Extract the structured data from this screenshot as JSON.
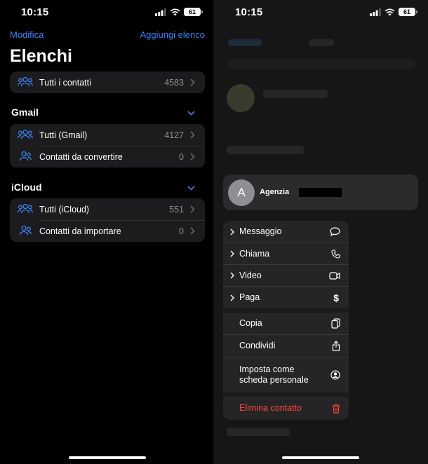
{
  "left_screen": {
    "status": {
      "time": "10:15",
      "battery": "61"
    },
    "nav": {
      "edit": "Modifica",
      "add_list": "Aggiungi elenco"
    },
    "title": "Elenchi",
    "all_contacts": {
      "label": "Tutti i contatti",
      "count": "4583"
    },
    "sections": [
      {
        "title": "Gmail",
        "rows": [
          {
            "label": "Tutti (Gmail)",
            "count": "4127"
          },
          {
            "label": "Contatti da convertire",
            "count": "0"
          }
        ]
      },
      {
        "title": "iCloud",
        "rows": [
          {
            "label": "Tutti (iCloud)",
            "count": "551"
          },
          {
            "label": "Contatti da importare",
            "count": "0"
          }
        ]
      }
    ]
  },
  "right_screen": {
    "status": {
      "time": "10:15",
      "battery": "61"
    },
    "contact": {
      "initial": "A",
      "name": "Agenzia"
    },
    "menu": {
      "message": "Messaggio",
      "call": "Chiama",
      "video": "Video",
      "pay": "Paga",
      "copy": "Copia",
      "share": "Condividi",
      "set_personal_line1": "Imposta come",
      "set_personal_line2": "scheda personale",
      "delete": "Elimina contatto"
    }
  },
  "colors": {
    "accent": "#3b82f6",
    "danger": "#ff453a",
    "row_bg": "#1c1c1e",
    "menu_bg": "#252527"
  }
}
